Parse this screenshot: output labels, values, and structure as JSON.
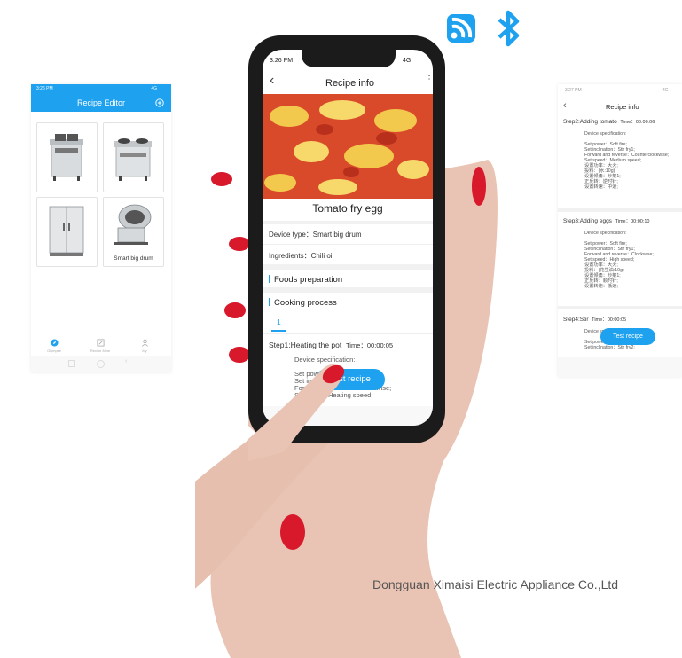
{
  "connectivity": {
    "icons": [
      "wifi-icon",
      "bluetooth-icon"
    ],
    "color": "#1ea1ee"
  },
  "left_screen": {
    "status_time": "3:26 PM",
    "status_signal": "4G",
    "title": "Recipe Editor",
    "add_icon": "plus-circle-icon",
    "cards": [
      {
        "label": ""
      },
      {
        "label": ""
      },
      {
        "label": ""
      },
      {
        "label": "Smart big drum"
      }
    ],
    "nav": [
      "Glympse",
      "Recipe Mine",
      "My"
    ]
  },
  "center_screen": {
    "status_time": "3:26 PM",
    "status_signal": "4G",
    "title": "Recipe info",
    "dish_name": "Tomato fry egg",
    "device_type": "Device type：Smart big drum",
    "ingredients": "Ingredients：Chili oil",
    "foods_preparation": "Foods preparation",
    "cooking_process": "Cooking process",
    "tab": "1",
    "step1": "Step1:Heating the pot",
    "step1_time": "Time：00:00:05",
    "device_spec": "Device specification:",
    "spec_lines": "Set power: Soft fire;\nSet inclination: Stir fry1;\nForward and reverse: Clockwise;\nSet speed: Heating speed;",
    "button": "Test recipe"
  },
  "right_screen": {
    "status_time": "3:27 PM",
    "status_signal": "4G",
    "title": "Recipe info",
    "steps": [
      {
        "title": "Step2:Adding tomato",
        "time": "Time：00:00:06",
        "spec": "Device specification:",
        "lines": "Set power：Soft fire;\nSet inclination：Stir fry1;\nForward and reverse：Counterclockwise;\nSet speed：Medium speed;\n设置功率：大火;\n投料：(水:10g)\n设置倾角：炒菜1;\n正反转：逆时针;\n设置转速：中速;"
      },
      {
        "title": "Step3:Adding eggs",
        "time": "Time：00:00:10",
        "spec": "Device specification:",
        "lines": "Set power：Soft fire;\nSet inclination：Stir fry1;\nForward and reverse：Clockwise;\nSet speed：High speed;\n设置功率：大火;\n投料：(花生油:10g)\n设置倾角：炒菜1;\n正反转：顺时针;\n设置转速：低速;"
      },
      {
        "title": "Step4:Stir",
        "time": "Time：00:00:05",
        "spec": "Device specification:",
        "lines": "Set power：Soft fire;\nSet inclination：Stir fry2;"
      }
    ],
    "button": "Test recipe"
  },
  "footer": {
    "company": "Dongguan Ximaisi Electric Appliance Co.,Ltd"
  }
}
